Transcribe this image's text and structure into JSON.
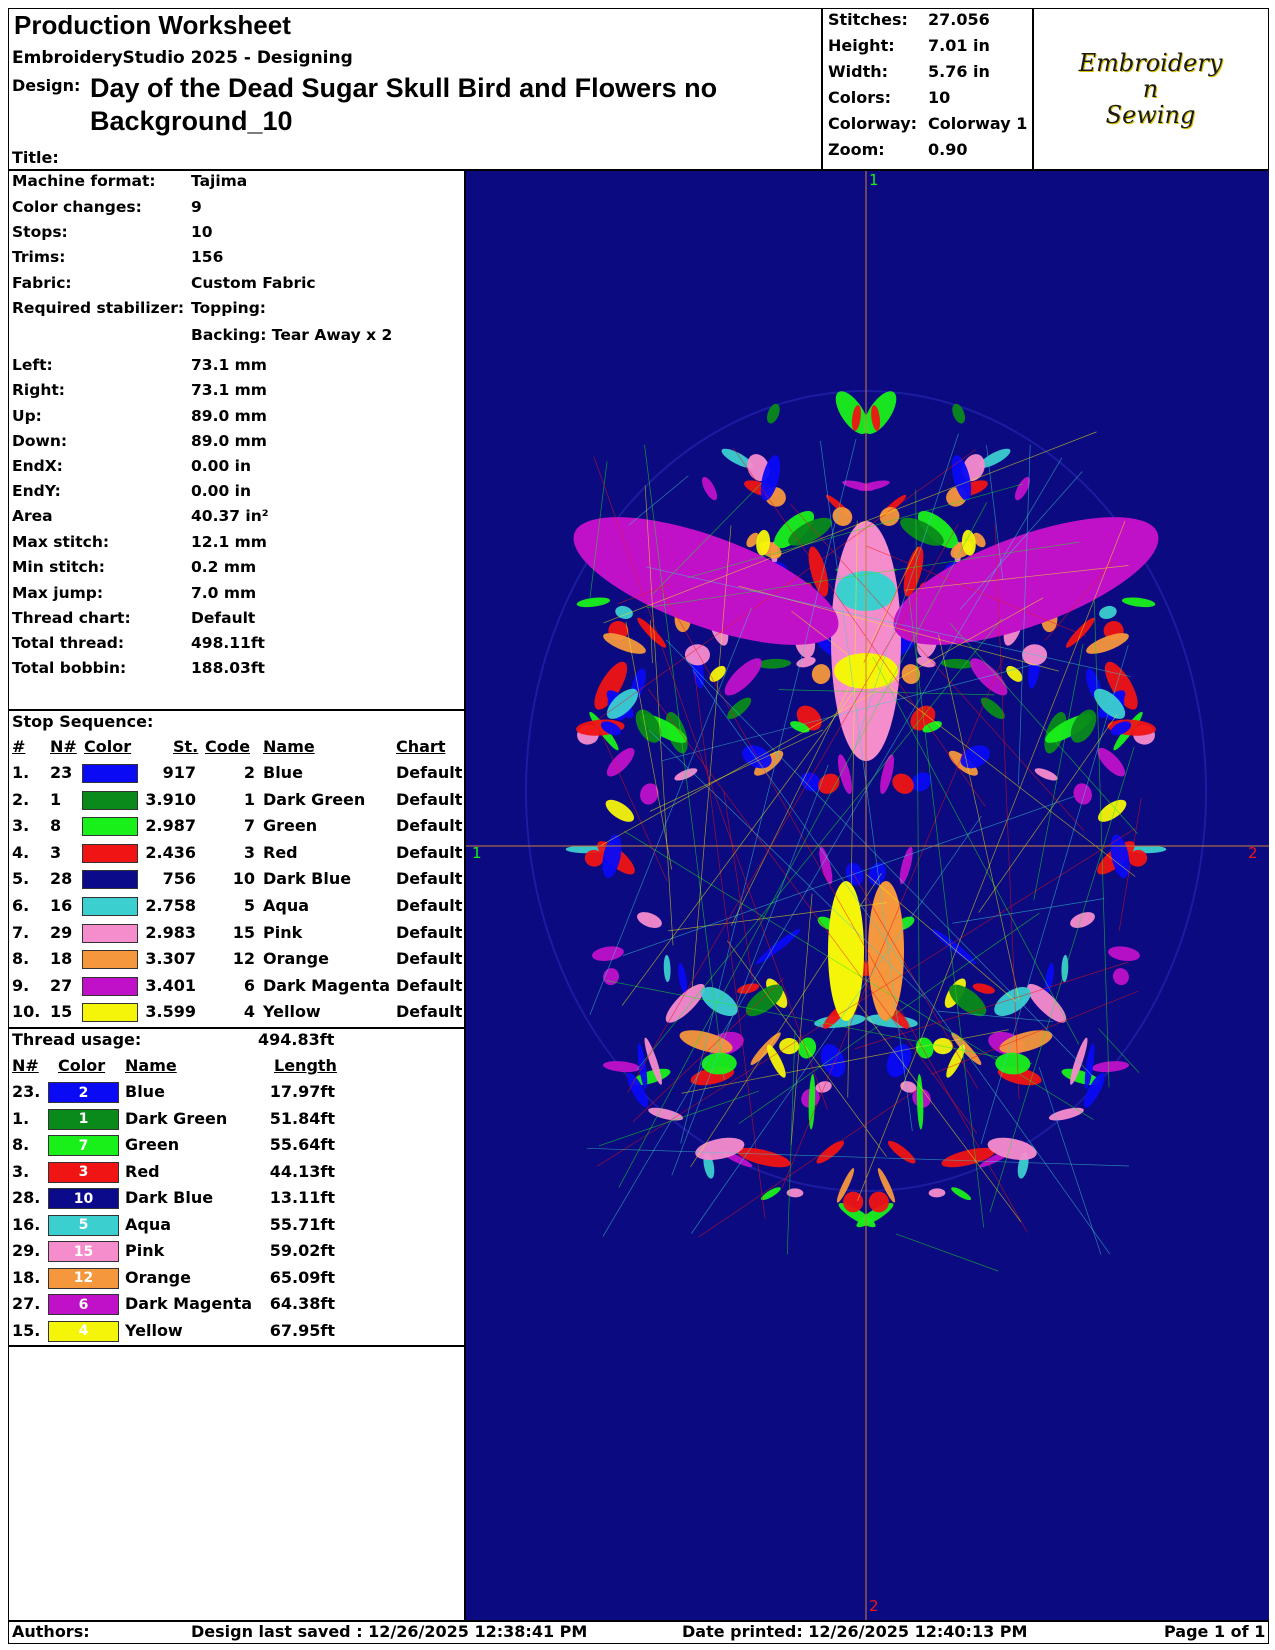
{
  "header": {
    "title": "Production Worksheet",
    "app": "EmbroideryStudio 2025 - Designing",
    "design_label": "Design:",
    "design_name": "Day of the Dead Sugar Skull Bird and Flowers no Background_10",
    "title_label": "Title:"
  },
  "stats": [
    {
      "label": "Stitches:",
      "value": "27.056"
    },
    {
      "label": "Height:",
      "value": "7.01 in"
    },
    {
      "label": "Width:",
      "value": "5.76 in"
    },
    {
      "label": "Colors:",
      "value": "10"
    },
    {
      "label": "Colorway:",
      "value": "Colorway 1"
    },
    {
      "label": "Zoom:",
      "value": "0.90"
    }
  ],
  "logo": {
    "line1": "Embroidery",
    "line2": "n",
    "line3": "Sewing"
  },
  "info": [
    {
      "label": "Machine format:",
      "value": "Tajima"
    },
    {
      "label": "Color changes:",
      "value": "9"
    },
    {
      "label": "Stops:",
      "value": "10"
    },
    {
      "label": "Trims:",
      "value": "156"
    },
    {
      "label": "Fabric:",
      "value": "Custom Fabric"
    },
    {
      "label": "Required stabilizer:",
      "value": "Topping:"
    },
    {
      "label": "",
      "value": "Backing: Tear Away x 2"
    },
    {
      "label": "Left:",
      "value": "73.1 mm"
    },
    {
      "label": "Right:",
      "value": "73.1 mm"
    },
    {
      "label": "Up:",
      "value": "89.0 mm"
    },
    {
      "label": "Down:",
      "value": "89.0 mm"
    },
    {
      "label": "EndX:",
      "value": "0.00 in"
    },
    {
      "label": "EndY:",
      "value": "0.00 in"
    },
    {
      "label": "Area",
      "value": " 40.37 in²"
    },
    {
      "label": "Max stitch:",
      "value": "12.1 mm"
    },
    {
      "label": "Min stitch:",
      "value": "0.2 mm"
    },
    {
      "label": "Max jump:",
      "value": "7.0 mm"
    },
    {
      "label": "Thread chart:",
      "value": "Default"
    },
    {
      "label": "Total thread:",
      "value": "498.11ft"
    },
    {
      "label": "Total bobbin:",
      "value": "188.03ft"
    }
  ],
  "stop_sequence": {
    "title": "Stop Sequence:",
    "headers": {
      "num": "#",
      "n": "N#",
      "color": "Color",
      "st": "St.",
      "code": "Code",
      "name": "Name",
      "chart": "Chart"
    },
    "rows": [
      {
        "num": "1.",
        "n": "23",
        "color": "#0a0af5",
        "st": "917",
        "code": "2",
        "name": "Blue",
        "chart": "Default"
      },
      {
        "num": "2.",
        "n": "1",
        "color": "#0a8a1a",
        "st": "3.910",
        "code": "1",
        "name": "Dark Green",
        "chart": "Default"
      },
      {
        "num": "3.",
        "n": "8",
        "color": "#19f019",
        "st": "2.987",
        "code": "7",
        "name": "Green",
        "chart": "Default"
      },
      {
        "num": "4.",
        "n": "3",
        "color": "#f01414",
        "st": "2.436",
        "code": "3",
        "name": "Red",
        "chart": "Default"
      },
      {
        "num": "5.",
        "n": "28",
        "color": "#0a0a8a",
        "st": "756",
        "code": "10",
        "name": "Dark Blue",
        "chart": "Default"
      },
      {
        "num": "6.",
        "n": "16",
        "color": "#3ccfcf",
        "st": "2.758",
        "code": "5",
        "name": "Aqua",
        "chart": "Default"
      },
      {
        "num": "7.",
        "n": "29",
        "color": "#f58ccb",
        "st": "2.983",
        "code": "15",
        "name": "Pink",
        "chart": "Default"
      },
      {
        "num": "8.",
        "n": "18",
        "color": "#f5973c",
        "st": "3.307",
        "code": "12",
        "name": "Orange",
        "chart": "Default"
      },
      {
        "num": "9.",
        "n": "27",
        "color": "#c011c9",
        "st": "3.401",
        "code": "6",
        "name": "Dark Magenta",
        "chart": "Default"
      },
      {
        "num": "10.",
        "n": "15",
        "color": "#f5f50a",
        "st": "3.599",
        "code": "4",
        "name": "Yellow",
        "chart": "Default"
      }
    ]
  },
  "thread_usage": {
    "title": "Thread usage:",
    "total": "494.83ft",
    "headers": {
      "n": "N#",
      "color": "Color",
      "name": "Name",
      "length": "Length"
    },
    "rows": [
      {
        "n": "23.",
        "code": "2",
        "color": "#0a0af5",
        "name": "Blue",
        "length": "17.97ft"
      },
      {
        "n": "1.",
        "code": "1",
        "color": "#0a8a1a",
        "name": "Dark Green",
        "length": "51.84ft"
      },
      {
        "n": "8.",
        "code": "7",
        "color": "#19f019",
        "name": "Green",
        "length": "55.64ft"
      },
      {
        "n": "3.",
        "code": "3",
        "color": "#f01414",
        "name": "Red",
        "length": "44.13ft"
      },
      {
        "n": "28.",
        "code": "10",
        "color": "#0a0a8a",
        "name": "Dark Blue",
        "length": "13.11ft"
      },
      {
        "n": "16.",
        "code": "5",
        "color": "#3ccfcf",
        "name": "Aqua",
        "length": "55.71ft"
      },
      {
        "n": "29.",
        "code": "15",
        "color": "#f58ccb",
        "name": "Pink",
        "length": "59.02ft"
      },
      {
        "n": "18.",
        "code": "12",
        "color": "#f5973c",
        "name": "Orange",
        "length": "65.09ft"
      },
      {
        "n": "27.",
        "code": "6",
        "color": "#c011c9",
        "name": "Dark Magenta",
        "length": "64.38ft"
      },
      {
        "n": "15.",
        "code": "4",
        "color": "#f5f50a",
        "name": "Yellow",
        "length": "67.95ft"
      }
    ]
  },
  "preview": {
    "background": "#0b0a80",
    "axis_labels": {
      "top": "1",
      "bottom": "2",
      "left": "1",
      "right": "2"
    }
  },
  "footer": {
    "authors": "Authors:",
    "last_saved": "Design last saved : 12/26/2025 12:38:41 PM",
    "printed": "Date printed: 12/26/2025 12:40:13 PM",
    "page": "Page 1 of 1"
  }
}
